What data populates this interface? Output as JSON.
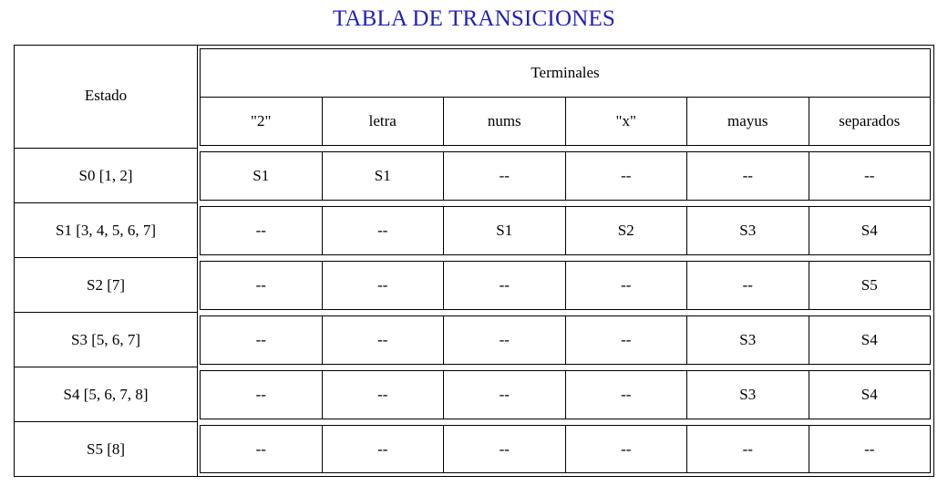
{
  "title": "TABLA DE TRANSICIONES",
  "table": {
    "estado_header": "Estado",
    "terminales_header": "Terminales",
    "columns": [
      "\"2\"",
      "letra",
      "nums",
      "\"x\"",
      "mayus",
      "separados"
    ],
    "rows": [
      {
        "estado": "S0 [1, 2]",
        "cells": [
          "S1",
          "S1",
          "--",
          "--",
          "--",
          "--"
        ]
      },
      {
        "estado": "S1 [3, 4, 5, 6, 7]",
        "cells": [
          "--",
          "--",
          "S1",
          "S2",
          "S3",
          "S4"
        ]
      },
      {
        "estado": "S2 [7]",
        "cells": [
          "--",
          "--",
          "--",
          "--",
          "--",
          "S5"
        ]
      },
      {
        "estado": "S3 [5, 6, 7]",
        "cells": [
          "--",
          "--",
          "--",
          "--",
          "S3",
          "S4"
        ]
      },
      {
        "estado": "S4 [5, 6, 7, 8]",
        "cells": [
          "--",
          "--",
          "--",
          "--",
          "S3",
          "S4"
        ]
      },
      {
        "estado": "S5 [8]",
        "cells": [
          "--",
          "--",
          "--",
          "--",
          "--",
          "--"
        ]
      }
    ]
  },
  "colors": {
    "title": "#1f1fbf",
    "border": "#000000"
  }
}
